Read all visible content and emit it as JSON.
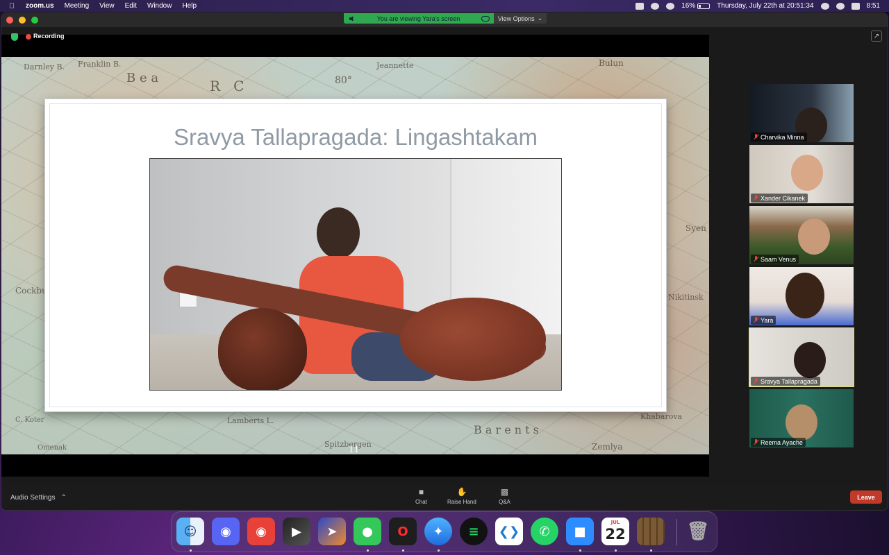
{
  "menubar": {
    "app_name": "zoom.us",
    "menus": [
      "Meeting",
      "View",
      "Edit",
      "Window",
      "Help"
    ],
    "battery_percent": "16%",
    "datetime": "Thursday, July 22th at 20:51:34",
    "clock": "8:51"
  },
  "banner": {
    "viewing_text": "You are viewing Yara's screen",
    "view_options": "View Options"
  },
  "recording": {
    "label": "Recording"
  },
  "slide": {
    "title": "Sravya Tallapragada: Lingashtakam",
    "number": "11"
  },
  "participants": [
    {
      "name": "Charvika Minna",
      "muted": true,
      "active": false
    },
    {
      "name": "Xander Cikanek",
      "muted": true,
      "active": false
    },
    {
      "name": "Saam Venus",
      "muted": true,
      "active": false
    },
    {
      "name": "Yara",
      "muted": true,
      "active": false
    },
    {
      "name": "Sravya Tallapragada",
      "muted": true,
      "active": true
    },
    {
      "name": "Reema Ayache",
      "muted": true,
      "active": false
    }
  ],
  "toolbar": {
    "audio_settings": "Audio Settings",
    "chat": "Chat",
    "raise_hand": "Raise Hand",
    "qa": "Q&A",
    "leave": "Leave"
  },
  "dock": {
    "calendar_month": "JUL",
    "calendar_day": "22",
    "apps": [
      "finder-icon",
      "discord-icon",
      "vpn-icon",
      "final-cut-icon",
      "rocket-icon",
      "messages-icon",
      "opera-icon",
      "safari-icon",
      "spotify-icon",
      "vscode-icon",
      "whatsapp-icon",
      "zoom-icon",
      "calendar-icon",
      "minecraft-icon",
      "trash-icon"
    ]
  }
}
